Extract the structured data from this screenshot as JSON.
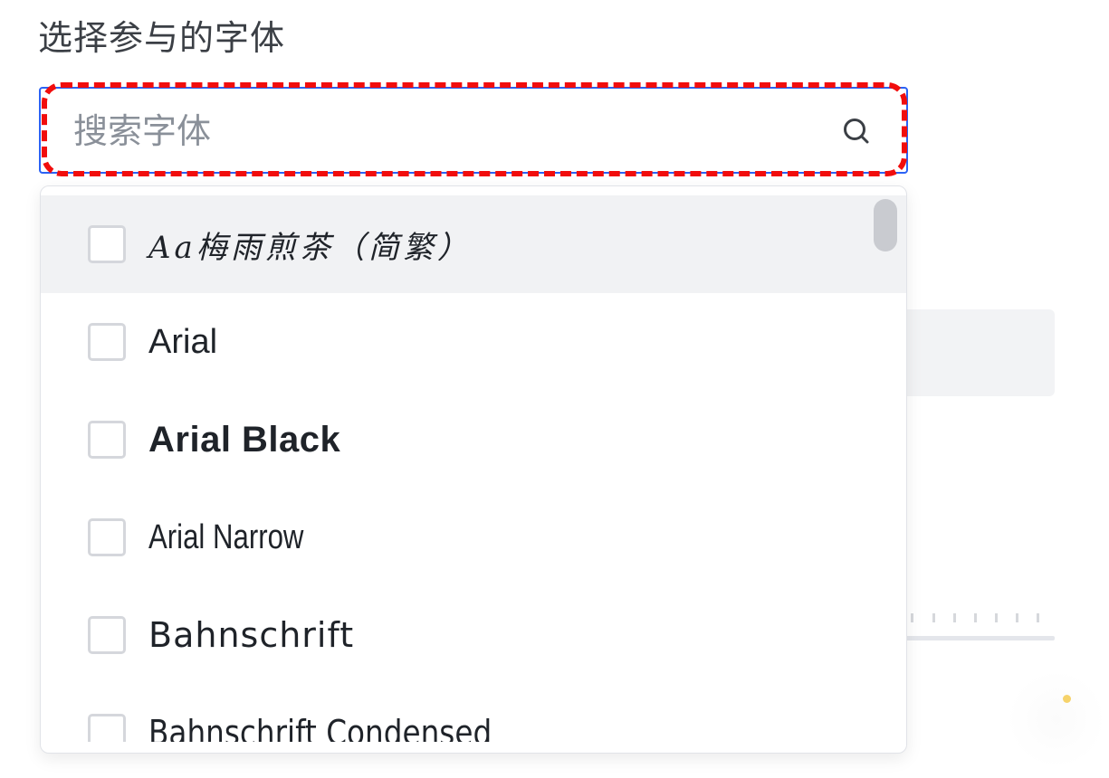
{
  "section": {
    "title": "选择参与的字体"
  },
  "search": {
    "placeholder": "搜索字体",
    "value": ""
  },
  "font_options": [
    {
      "label": "Aa梅雨煎茶（简繁）",
      "checked": false
    },
    {
      "label": "Arial",
      "checked": false
    },
    {
      "label": "Arial Black",
      "checked": false
    },
    {
      "label": "Arial Narrow",
      "checked": false
    },
    {
      "label": "Bahnschrift",
      "checked": false
    },
    {
      "label": "Bahnschrift Condensed",
      "checked": false
    }
  ],
  "colors": {
    "focus_border": "#2b62f5",
    "highlight_dashed": "#f10d0d",
    "hover_row": "#f1f2f4",
    "checkbox_border": "#d5d7dc"
  },
  "icons": {
    "search": "magnifier-icon"
  }
}
